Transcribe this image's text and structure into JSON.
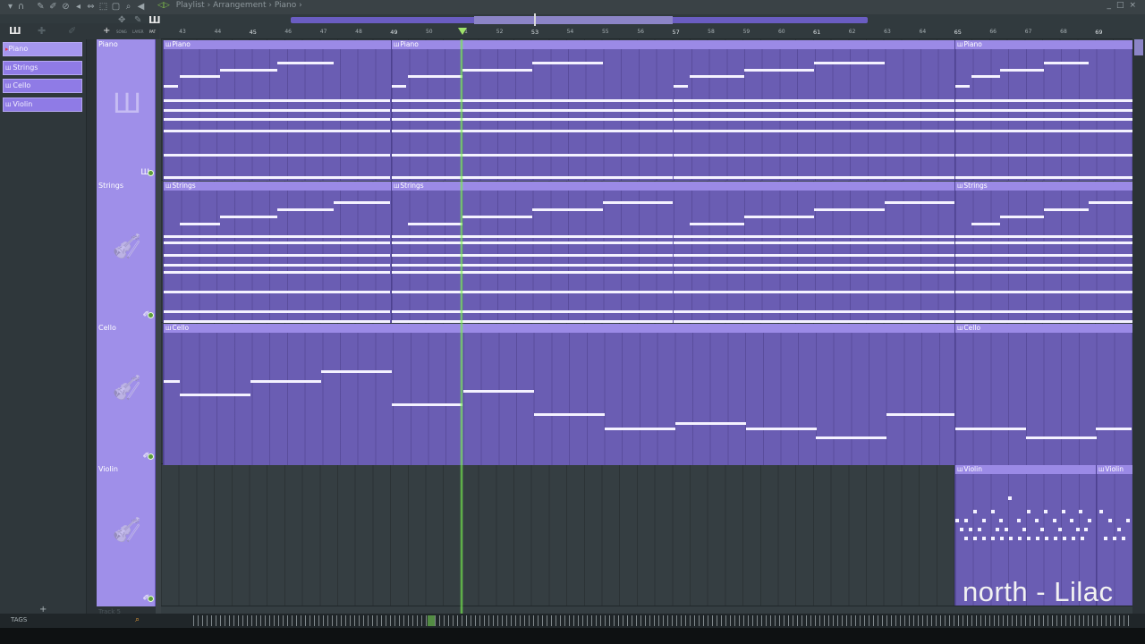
{
  "window": {
    "breadcrumb": [
      "Playlist",
      "Arrangement",
      "Piano"
    ],
    "controls": [
      "_",
      "□",
      "×"
    ]
  },
  "toolbar": {
    "tools": [
      "magnet-icon",
      "pencil-icon",
      "brush-icon",
      "mute-icon",
      "slip-icon",
      "slice-icon",
      "select-icon",
      "zoom-icon",
      "playback-icon"
    ],
    "mini_labels": [
      "PAT",
      "SONG",
      "LAYER"
    ]
  },
  "ruler": {
    "bars": [
      43,
      44,
      45,
      46,
      47,
      48,
      49,
      50,
      51,
      52,
      53,
      54,
      55,
      56,
      57,
      58,
      59,
      60,
      61,
      62,
      63,
      64,
      65,
      66,
      67,
      68,
      69
    ],
    "major": [
      45,
      49,
      53,
      57,
      61,
      65,
      69
    ]
  },
  "patterns": [
    {
      "name": "Piano",
      "selected": true
    },
    {
      "name": "Strings",
      "selected": false
    },
    {
      "name": "Cello",
      "selected": false
    },
    {
      "name": "Violin",
      "selected": false
    }
  ],
  "tracks": [
    {
      "name": "Piano",
      "icon": "piano-icon"
    },
    {
      "name": "Strings",
      "icon": "violin-icon"
    },
    {
      "name": "Cello",
      "icon": "violin-icon"
    },
    {
      "name": "Violin",
      "icon": "violin-icon"
    }
  ],
  "clips": {
    "piano": [
      "Piano",
      "Piano",
      "Piano"
    ],
    "strings": [
      "Strings",
      "Strings",
      "Strings"
    ],
    "cello": [
      "Cello",
      "Cello"
    ],
    "violin": [
      "Violin",
      "Violin"
    ]
  },
  "bottom": {
    "tags_label": "TAGS",
    "track5_label": "Track 5"
  },
  "overlay": {
    "song_title": "north - Lilac"
  },
  "colors": {
    "clip": "#6a5db3",
    "clip_header": "#9b8ae6",
    "track_header": "#9f8fe9",
    "playhead": "#78f050"
  }
}
